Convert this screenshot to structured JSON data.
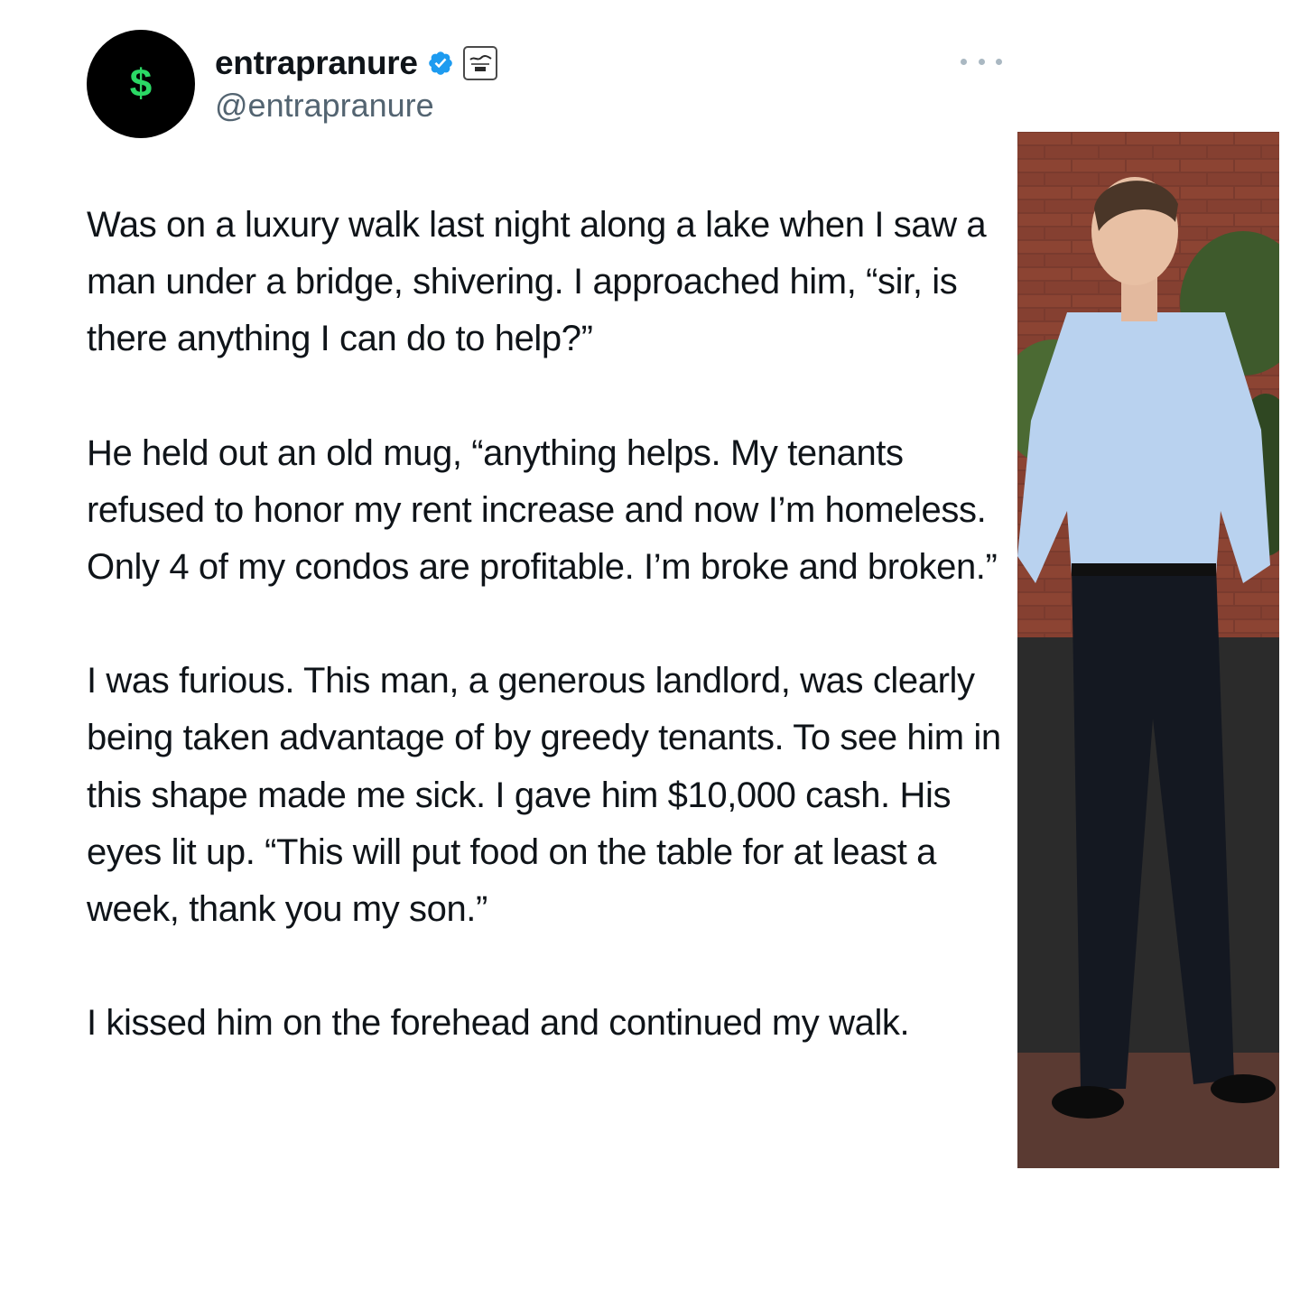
{
  "author": {
    "avatar_glyph": "$",
    "display_name": "entrapranure",
    "handle": "@entrapranure",
    "verified_icon": "verified-badge-icon",
    "affiliate_badge": "friday-beers-badge"
  },
  "menu": {
    "more_icon": "more-horizontal-icon"
  },
  "tweet": {
    "paragraphs": [
      "Was on a luxury walk last night along a lake when I saw a man under a bridge, shivering. I approached him, “sir, is there anything I can do to help?”",
      "He held out an old mug, “anything helps. My tenants refused to honor my rent increase and now I’m homeless. Only 4 of my condos are profitable. I’m broke and broken.”",
      "I was furious. This man, a generous landlord, was clearly being taken advantage of by greedy tenants. To see him in this shape made me sick. I gave him $10,000 cash. His eyes lit up. “This will put food on the table for at least a week, thank you my son.”",
      "I kissed him on the forehead and continued my walk."
    ]
  },
  "colors": {
    "text": "#0f1419",
    "secondary": "#536471",
    "verified": "#1d9bf0",
    "avatar_bg": "#000000",
    "avatar_glyph": "#2bd965"
  }
}
